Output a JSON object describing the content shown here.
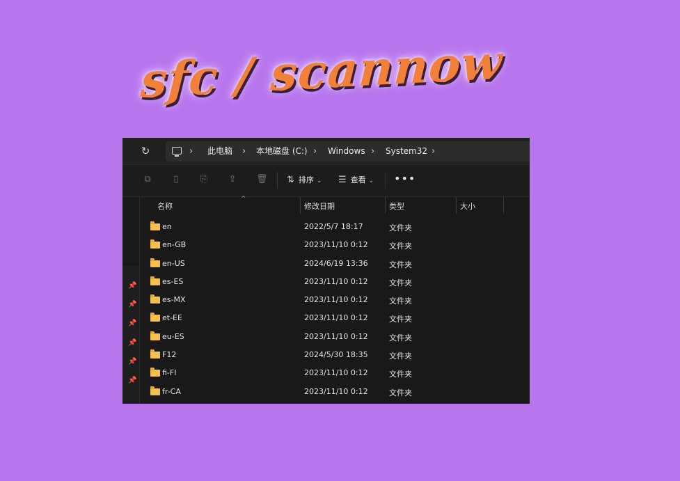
{
  "banner": {
    "text": "sfc / scannow"
  },
  "address_bar": {
    "breadcrumbs": [
      "此电脑",
      "本地磁盘 (C:)",
      "Windows",
      "System32"
    ]
  },
  "toolbar": {
    "sort_label": "排序",
    "view_label": "查看",
    "more_label": "•••"
  },
  "columns": {
    "name": "名称",
    "date": "修改日期",
    "type": "类型",
    "size": "大小"
  },
  "files": [
    {
      "name": "en",
      "date": "2022/5/7 18:17",
      "type": "文件夹"
    },
    {
      "name": "en-GB",
      "date": "2023/11/10 0:12",
      "type": "文件夹"
    },
    {
      "name": "en-US",
      "date": "2024/6/19 13:36",
      "type": "文件夹"
    },
    {
      "name": "es-ES",
      "date": "2023/11/10 0:12",
      "type": "文件夹"
    },
    {
      "name": "es-MX",
      "date": "2023/11/10 0:12",
      "type": "文件夹"
    },
    {
      "name": "et-EE",
      "date": "2023/11/10 0:12",
      "type": "文件夹"
    },
    {
      "name": "eu-ES",
      "date": "2023/11/10 0:12",
      "type": "文件夹"
    },
    {
      "name": "F12",
      "date": "2024/5/30 18:35",
      "type": "文件夹"
    },
    {
      "name": "fi-FI",
      "date": "2023/11/10 0:12",
      "type": "文件夹"
    },
    {
      "name": "fr-CA",
      "date": "2023/11/10 0:12",
      "type": "文件夹"
    }
  ]
}
